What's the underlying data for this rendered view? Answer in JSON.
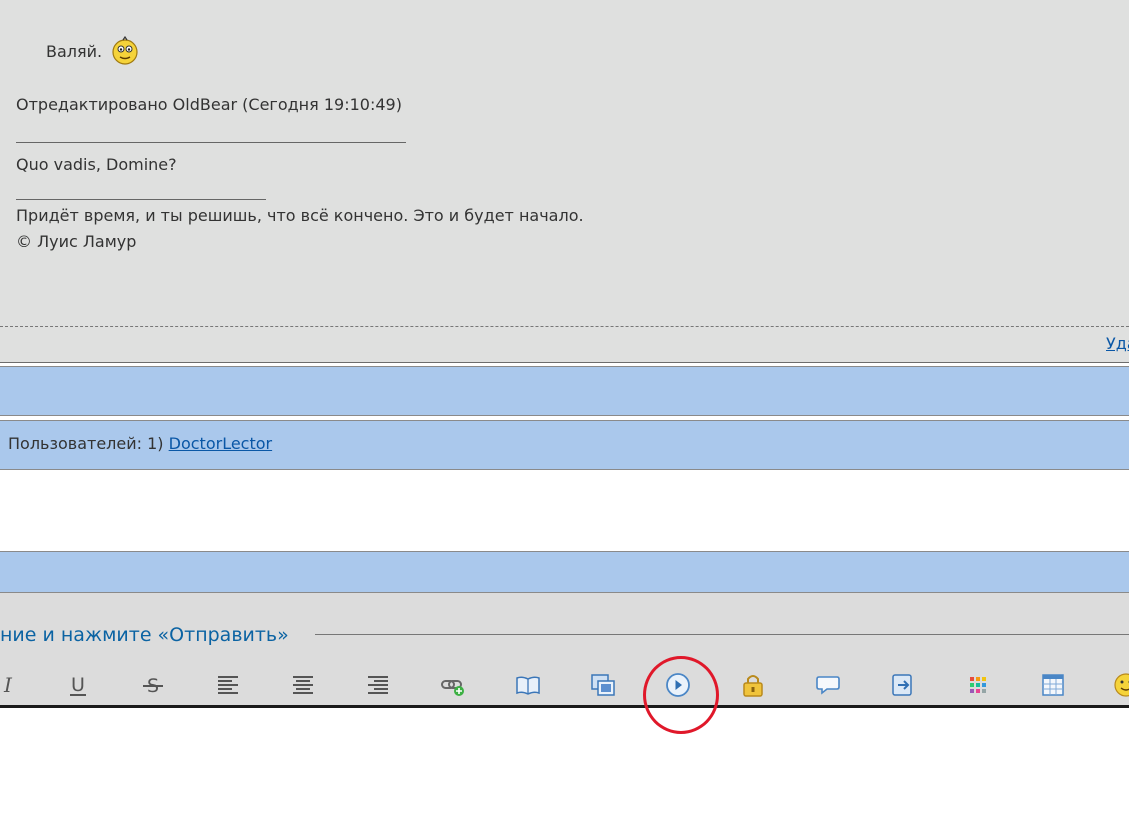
{
  "post": {
    "quote_text": "Валяй.",
    "edited_note": "Отредактировано OldBear (Сегодня 19:10:49)",
    "signature": {
      "line1": "Quo vadis, Domine?",
      "line2": "Придёт время, и ты решишь, что всё кончено. Это и будет начало.",
      "line3": "© Луис Ламур"
    },
    "delete_link": "Удалить"
  },
  "online": {
    "users_label": "Пользователей: 1)",
    "user_name": "DoctorLector"
  },
  "reply": {
    "legend": "ние и нажмите «Отправить»"
  },
  "toolbar": {
    "buttons": [
      "italic-icon",
      "underline-icon",
      "strikethrough-icon",
      "align-left-icon",
      "align-center-icon",
      "align-right-icon",
      "link-icon",
      "book-icon",
      "image-icon",
      "video-icon",
      "lock-icon",
      "comment-icon",
      "script-icon",
      "color-palette-icon",
      "table-icon",
      "smiley-icon"
    ]
  },
  "colors": {
    "post_bg": "#dfe0df",
    "bar_blue": "#aac8ec",
    "link_blue": "#0a57a6",
    "highlight_red": "#e0182a"
  }
}
